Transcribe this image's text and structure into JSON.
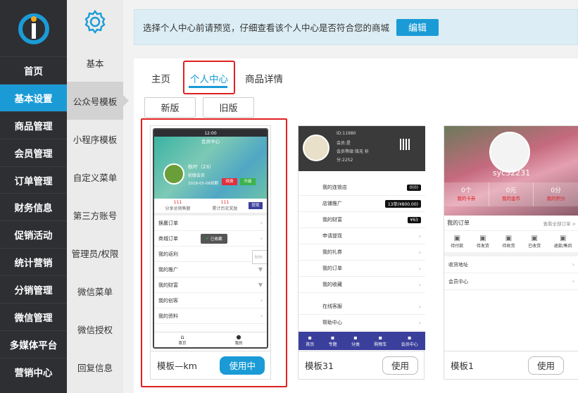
{
  "nav": {
    "items": [
      "首页",
      "基本设置",
      "商品管理",
      "会员管理",
      "订单管理",
      "财务信息",
      "促销活动",
      "统计营销",
      "分销管理",
      "微信管理",
      "多媒体平台",
      "营销中心"
    ],
    "active_index": 1
  },
  "sub": {
    "items": [
      "基本",
      "公众号模板",
      "小程序模板",
      "自定义菜单",
      "第三方账号",
      "管理员/权限",
      "微信菜单",
      "微信授权",
      "回复信息"
    ],
    "active_index": 1
  },
  "notice": {
    "text": "选择个人中心前请预览，仔细查看该个人中心是否符合您的商城",
    "edit": "编辑"
  },
  "tabs": [
    "主页",
    "个人中心",
    "商品详情"
  ],
  "versions": [
    "新版",
    "旧版"
  ],
  "cards": [
    {
      "name": "模板—km",
      "button": "使用中"
    },
    {
      "name": "模板31",
      "button": "使用"
    },
    {
      "name": "模板1",
      "button": "使用"
    }
  ],
  "preview1": {
    "time": "12:00",
    "title": "会员中心",
    "username": "秋叶（23）",
    "level": "初级会员",
    "date": "2018-05-06到期",
    "btn1": "续费",
    "btn2": "升级",
    "stat1_val": "111",
    "stat1_label": "分享总销售额",
    "stat2_val": "111",
    "stat2_label": "累计历史奖励",
    "stat_btn": "提现",
    "rows": [
      "换赢订单",
      "商城订单",
      "我的返利",
      "我的推广",
      "我的财富",
      "我的创客",
      "我的资料"
    ],
    "toast": "已收藏",
    "tooltip": "km",
    "bottom": [
      "首页",
      "我的"
    ]
  },
  "preview2": {
    "id": "ID:11980",
    "member": "会员:是",
    "level": "会员等级:铭无",
    "level2": "析",
    "points": "分:2252",
    "rows": [
      {
        "label": "我的连锁店",
        "val": "0(0)"
      },
      {
        "label": "店铺推广",
        "val": "13单(¥800.00)"
      },
      {
        "label": "我的财富",
        "val": "¥63"
      },
      {
        "label": "申请提现",
        "val": ""
      },
      {
        "label": "我的礼券",
        "val": ""
      },
      {
        "label": "我的订单",
        "val": ""
      },
      {
        "label": "我的收藏",
        "val": ""
      },
      {
        "label": "在线客服",
        "val": ""
      },
      {
        "label": "帮助中心",
        "val": ""
      }
    ],
    "tabs": [
      "首页",
      "专题",
      "分类",
      "购物车",
      "会员中心"
    ]
  },
  "preview3": {
    "username": "syc32231",
    "stats": [
      {
        "val": "0个",
        "label": "我的卡券"
      },
      {
        "val": "0元",
        "label": "我的金币"
      },
      {
        "val": "0分",
        "label": "我的积分"
      }
    ],
    "orders_title": "我的订单",
    "orders_all": "查看全部订单 >",
    "order_items": [
      "待付款",
      "待发货",
      "待收货",
      "已收货",
      "退款/售后"
    ],
    "rows": [
      "收货地址",
      "会员中心"
    ]
  },
  "colors": {
    "nav_bg": "#2d2f33",
    "accent": "#1a9bd6",
    "highlight": "#e02020",
    "purple": "#3b3f9c"
  }
}
